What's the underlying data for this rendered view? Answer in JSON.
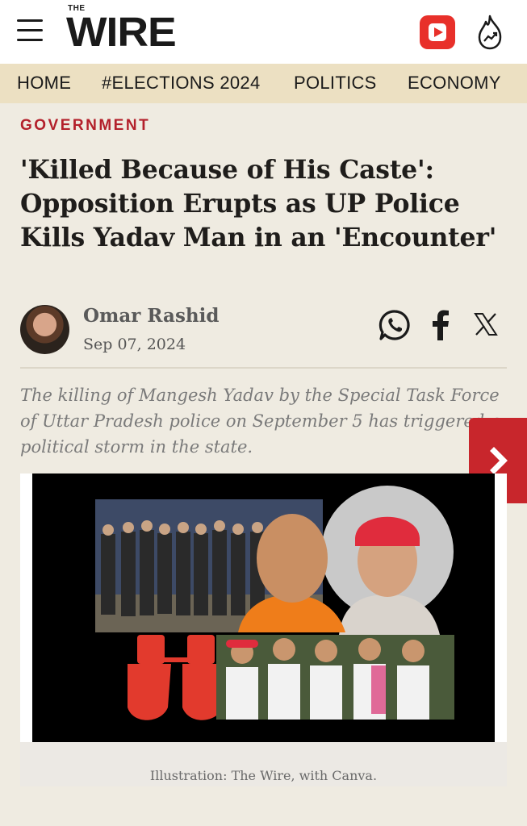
{
  "header": {
    "logo_small": "THE",
    "logo_main": "WIRE"
  },
  "nav": {
    "items": [
      "HOME",
      "#ELECTIONS 2024",
      "POLITICS",
      "ECONOMY"
    ]
  },
  "article": {
    "category": "GOVERNMENT",
    "title": "'Killed Because of His Caste': Opposition Erupts as UP Police Kills Yadav Man in an 'Encounter'",
    "author": "Omar Rashid",
    "date": "Sep 07, 2024",
    "excerpt": "The killing of Mangesh Yadav by the Special Task Force of Uttar Pradesh police on September 5 has triggered a political storm in the state.",
    "caption": "Illustration: The Wire, with Canva."
  },
  "share": {
    "icons": [
      "whatsapp-icon",
      "facebook-icon",
      "x-icon"
    ]
  },
  "colors": {
    "accent": "#b3202b",
    "nav_bg": "#ece0c2",
    "page_bg": "#efebe1",
    "next_button": "#c8262c"
  }
}
